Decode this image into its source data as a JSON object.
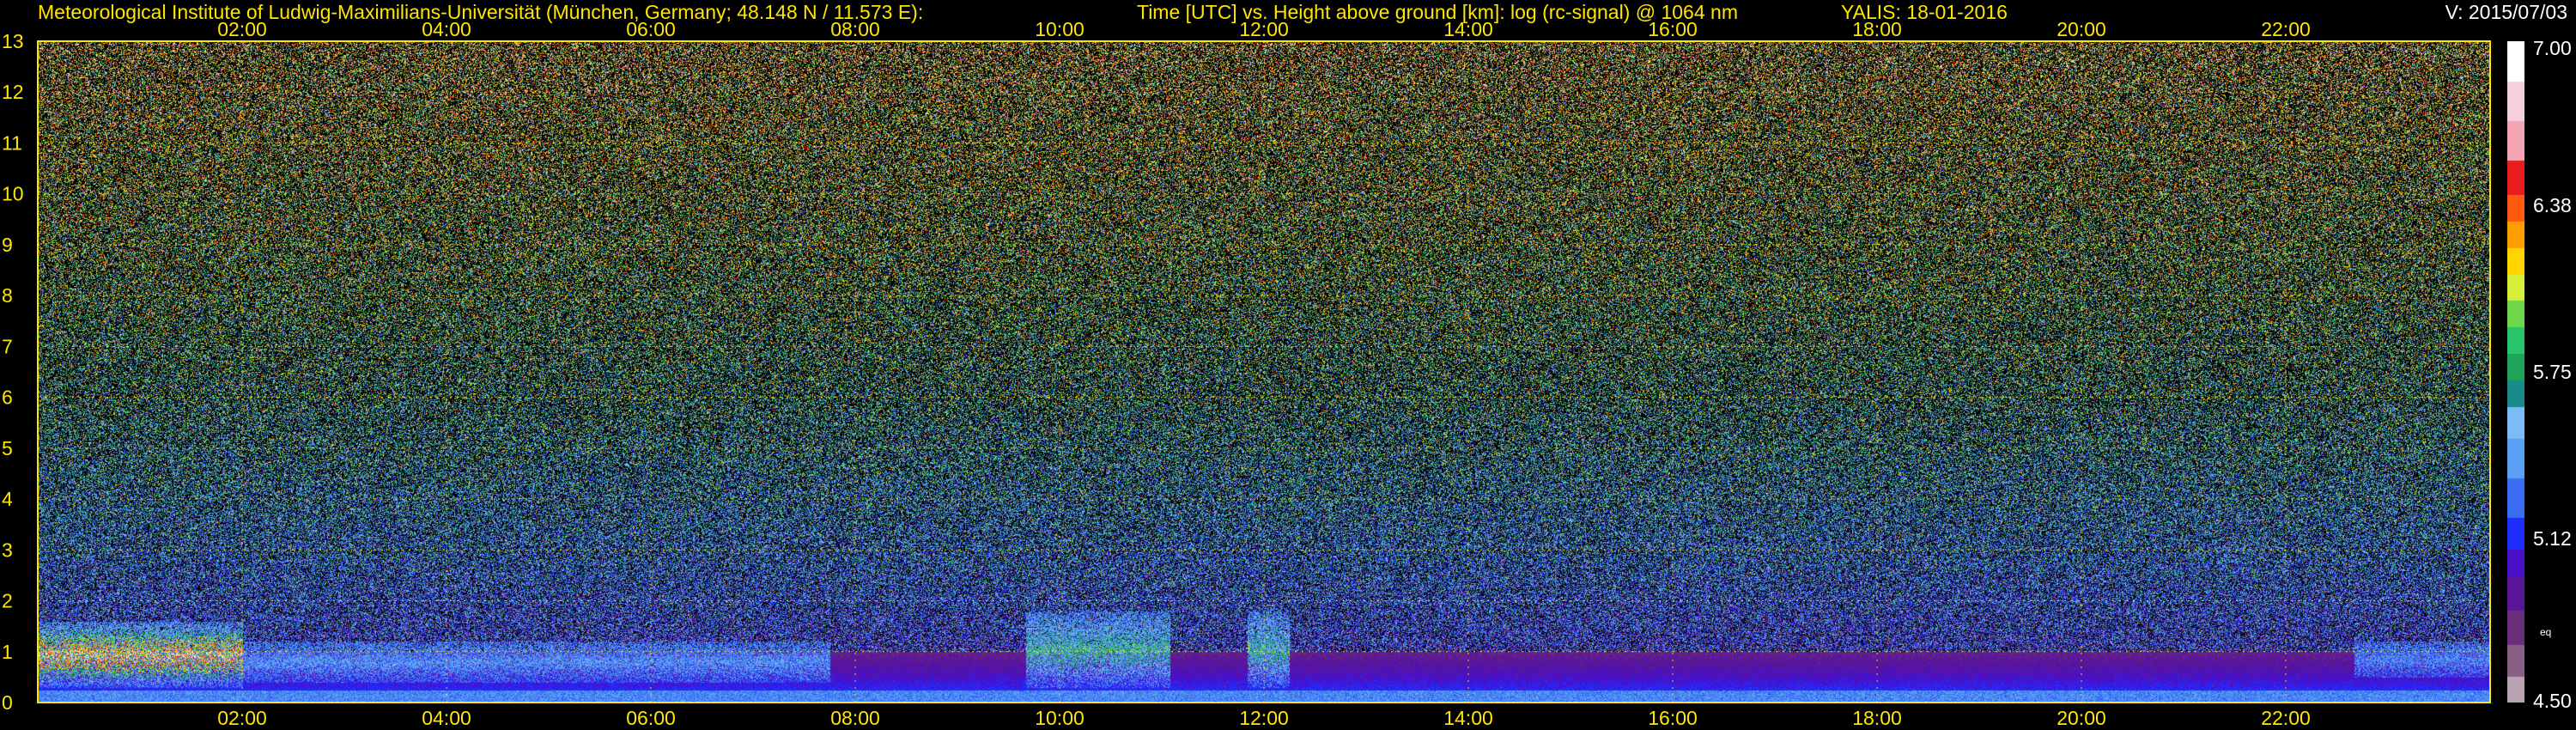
{
  "header": {
    "institute": "Meteorological Institute of Ludwig-Maximilians-Universität (München, Germany; 48.148 N / 11.573 E):",
    "description": "Time [UTC] vs. Height above ground [km]: log (rc-signal) @ 1064 nm",
    "instrument_date": "YALIS: 18-01-2016",
    "version": "V: 2015/07/03"
  },
  "colors": {
    "text_yellow": "#ffe600",
    "background": "#000000",
    "grid": "#ffe600"
  },
  "chart_data": {
    "type": "heatmap",
    "title": "",
    "xlabel": "Time [UTC]",
    "ylabel": "Height above ground [km]",
    "x_ticks": [
      "02:00",
      "04:00",
      "06:00",
      "08:00",
      "10:00",
      "12:00",
      "14:00",
      "16:00",
      "18:00",
      "20:00",
      "22:00"
    ],
    "x_tick_hours": [
      2,
      4,
      6,
      8,
      10,
      12,
      14,
      16,
      18,
      20,
      22
    ],
    "xlim_hours": [
      0,
      24
    ],
    "y_ticks": [
      "0",
      "1",
      "2",
      "3",
      "4",
      "5",
      "6",
      "7",
      "8",
      "9",
      "10",
      "11",
      "12",
      "13"
    ],
    "ylim_km": [
      0,
      13
    ],
    "grid": true,
    "colorbar": {
      "label": "log (rc-signal)",
      "range": [
        4.5,
        7.0
      ],
      "tick_labels": [
        "7.00",
        "6.38",
        "5.75",
        "5.12",
        "4.50"
      ],
      "tick_values": [
        7.0,
        6.38,
        5.75,
        5.12,
        4.5
      ],
      "eq_label": "eq",
      "levels": [
        {
          "v": 4.5,
          "c": "#b9a3b3"
        },
        {
          "v": 4.6,
          "c": "#8a5f86"
        },
        {
          "v": 4.72,
          "c": "#6a2f7a"
        },
        {
          "v": 4.85,
          "c": "#5a1699"
        },
        {
          "v": 4.98,
          "c": "#4a10c8"
        },
        {
          "v": 5.08,
          "c": "#1f2dff"
        },
        {
          "v": 5.2,
          "c": "#3a6df2"
        },
        {
          "v": 5.35,
          "c": "#5aa0f5"
        },
        {
          "v": 5.5,
          "c": "#7bbcf7"
        },
        {
          "v": 5.62,
          "c": "#1a8a8a"
        },
        {
          "v": 5.72,
          "c": "#1da35a"
        },
        {
          "v": 5.82,
          "c": "#28c46a"
        },
        {
          "v": 5.92,
          "c": "#6fd84a"
        },
        {
          "v": 6.02,
          "c": "#d5ef3a"
        },
        {
          "v": 6.12,
          "c": "#ffd400"
        },
        {
          "v": 6.22,
          "c": "#ff9e00"
        },
        {
          "v": 6.32,
          "c": "#ff5a10"
        },
        {
          "v": 6.42,
          "c": "#e81c1c"
        },
        {
          "v": 6.55,
          "c": "#f3a5b5"
        },
        {
          "v": 6.7,
          "c": "#f5d0dc"
        },
        {
          "v": 6.85,
          "c": "#ffffff"
        }
      ]
    },
    "features": {
      "noise_floor_km": [
        0,
        13
      ],
      "aerosol_layer_top_km": 1.0,
      "cloud_events": [
        {
          "start": "00:00",
          "end": "02:00",
          "height_km": [
            0.3,
            1.6
          ],
          "max_value": 7.0
        },
        {
          "start": "02:00",
          "end": "07:45",
          "height_km": [
            0.4,
            1.2
          ],
          "max_value": 5.4
        },
        {
          "start": "09:40",
          "end": "11:05",
          "height_km": [
            0.3,
            1.8
          ],
          "max_value": 5.9
        },
        {
          "start": "11:50",
          "end": "12:15",
          "height_km": [
            0.3,
            1.8
          ],
          "max_value": 5.9
        },
        {
          "start": "22:40",
          "end": "24:00",
          "height_km": [
            0.5,
            1.2
          ],
          "max_value": 5.3
        }
      ]
    }
  }
}
